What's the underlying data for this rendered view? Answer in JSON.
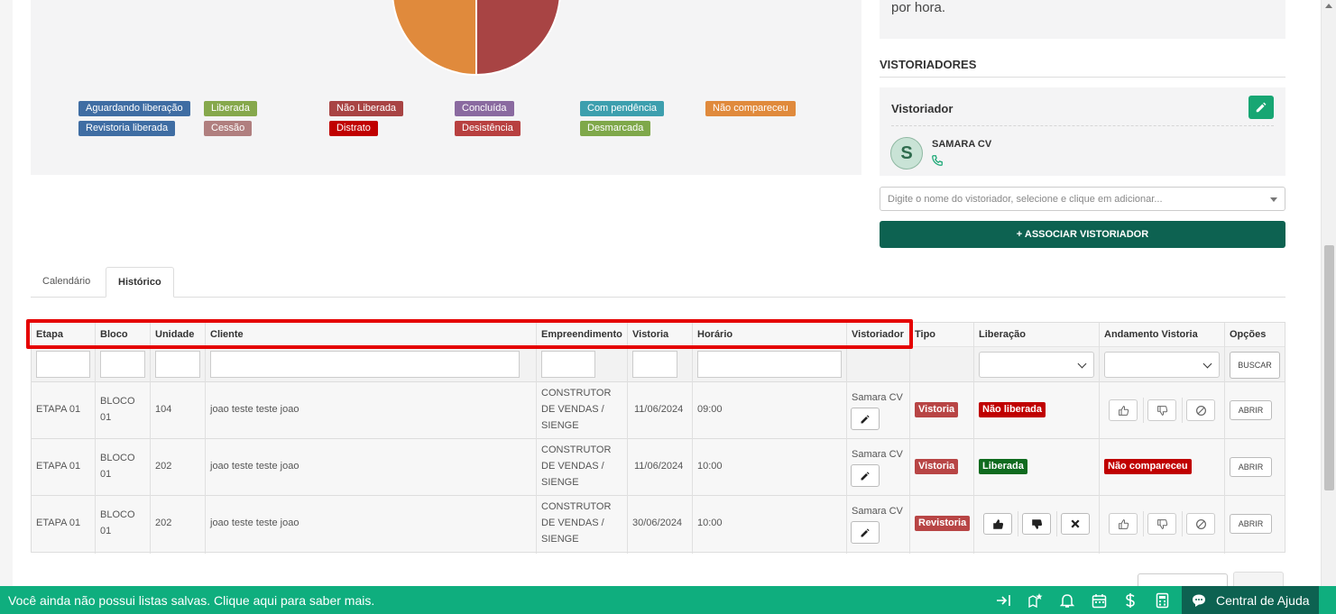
{
  "chart_data": {
    "type": "pie",
    "legend": [
      {
        "label": "Aguardando liberação",
        "color": "#3f6da3"
      },
      {
        "label": "Liberada",
        "color": "#86a84c"
      },
      {
        "label": "Não Liberada",
        "color": "#a84444"
      },
      {
        "label": "Concluída",
        "color": "#8a6aa0"
      },
      {
        "label": "Com pendência",
        "color": "#3d9fae"
      },
      {
        "label": "Não compareceu",
        "color": "#e08a3c"
      },
      {
        "label": "Revistoria liberada",
        "color": "#3f6da3"
      },
      {
        "label": "Cessão",
        "color": "#b07f7f"
      },
      {
        "label": "Distrato",
        "color": "#c00000"
      },
      {
        "label": "Desistência",
        "color": "#b84040"
      },
      {
        "label": "Desmarcada",
        "color": "#7fa84a"
      }
    ],
    "slices": [
      {
        "label": "Não Liberada",
        "value": 1,
        "color": "#a84444"
      },
      {
        "label": "Não compareceu",
        "value": 1,
        "color": "#e08a3c"
      }
    ]
  },
  "note": {
    "text": "por hora."
  },
  "inspectors": {
    "section_title": "VISTORIADORES",
    "card_title": "Vistoriador",
    "avatar_letter": "S",
    "name": "SAMARA CV",
    "select_placeholder": "Digite o nome do vistoriador, selecione e clique em adicionar...",
    "associate_label": "+ ASSOCIAR VISTORIADOR"
  },
  "tabs": [
    {
      "label": "Calendário",
      "active": false
    },
    {
      "label": "Histórico",
      "active": true
    }
  ],
  "table": {
    "headers": {
      "etapa": "Etapa",
      "bloco": "Bloco",
      "unidade": "Unidade",
      "cliente": "Cliente",
      "empreendimento": "Empreendimento",
      "vistoria": "Vistoria",
      "horario": "Horário",
      "vistoriador": "Vistoriador",
      "tipo": "Tipo",
      "liberacao": "Liberação",
      "andamento": "Andamento Vistoria",
      "opcoes": "Opções"
    },
    "search_label": "BUSCAR",
    "open_label": "ABRIR",
    "rows": [
      {
        "etapa": "ETAPA 01",
        "bloco": "BLOCO 01",
        "unidade": "104",
        "cliente": "joao teste teste joao",
        "empreendimento": "CONSTRUTOR DE VENDAS / SIENGE",
        "vistoria": "11/06/2024",
        "horario": "09:00",
        "vistoriador": "Samara CV",
        "tipo": "Vistoria",
        "liberacao": "Não liberada",
        "andamento": ""
      },
      {
        "etapa": "ETAPA 01",
        "bloco": "BLOCO 01",
        "unidade": "202",
        "cliente": "joao teste teste joao",
        "empreendimento": "CONSTRUTOR DE VENDAS / SIENGE",
        "vistoria": "11/06/2024",
        "horario": "10:00",
        "vistoriador": "Samara CV",
        "tipo": "Vistoria",
        "liberacao": "Liberada",
        "andamento": "Não compareceu"
      },
      {
        "etapa": "ETAPA 01",
        "bloco": "BLOCO 01",
        "unidade": "202",
        "cliente": "joao teste teste joao",
        "empreendimento": "CONSTRUTOR DE VENDAS / SIENGE",
        "vistoria": "30/06/2024",
        "horario": "10:00",
        "vistoriador": "Samara CV",
        "tipo": "Revistoria",
        "liberacao": "",
        "andamento": ""
      }
    ]
  },
  "bottombar": {
    "message": "Você ainda não possui listas salvas. Clique aqui para saber mais.",
    "help_label": "Central de Ajuda",
    "icons": [
      "exit-arrow-icon",
      "map-star-icon",
      "bell-icon",
      "calendar-icon",
      "dollar-icon",
      "calculator-icon",
      "chat-icon"
    ]
  },
  "colors": {
    "primary_dark": "#0d6251",
    "bottombar": "#0fae7e",
    "highlight": "#e50000",
    "badge_red": "#c00000",
    "badge_green": "#0f6b1f",
    "badge_tipo": "#b84545"
  }
}
